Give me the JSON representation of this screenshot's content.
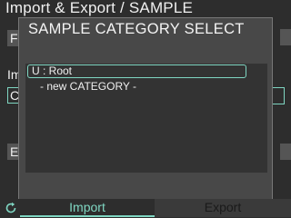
{
  "window": {
    "title": "Import & Export / SAMPLE",
    "stubs": [
      "F",
      "Im",
      "C",
      "E"
    ]
  },
  "dialog": {
    "title": "SAMPLE CATEGORY SELECT",
    "items": [
      {
        "label": "U : Root",
        "selected": true
      },
      {
        "label": "- new CATEGORY -",
        "selected": false
      }
    ]
  },
  "bottom_bar": {
    "refresh_icon": "refresh-icon",
    "import_label": "Import",
    "export_label": "Export"
  },
  "colors": {
    "accent": "#7fd6c2",
    "background": "#2d2d2d",
    "dialog": "#484848",
    "list": "#333333"
  }
}
